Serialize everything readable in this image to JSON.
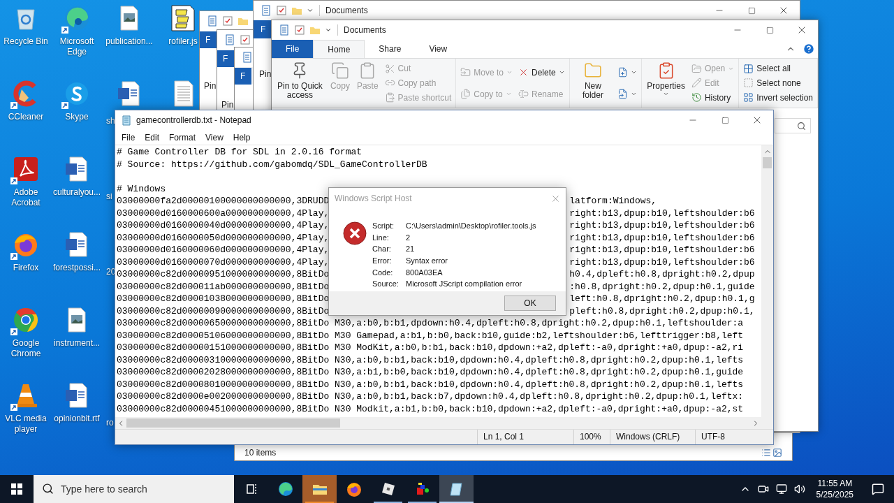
{
  "desktop": {
    "icons": [
      {
        "label": "Recycle Bin",
        "kind": "recycle",
        "shortcut": false
      },
      {
        "label": "Microsoft Edge",
        "kind": "edge",
        "shortcut": true
      },
      {
        "label": "publication...",
        "kind": "image",
        "shortcut": false
      },
      {
        "label": "rofiler.js",
        "kind": "script",
        "shortcut": false
      },
      {
        "label": "CCleaner",
        "kind": "ccleaner",
        "shortcut": true
      },
      {
        "label": "Skype",
        "kind": "skype",
        "shortcut": true
      },
      {
        "label": "sh",
        "kind": "word",
        "shortcut": false
      },
      {
        "kind": "text",
        "shortcut": false
      },
      {
        "label": "Adobe Acrobat",
        "kind": "acrobat",
        "shortcut": true
      },
      {
        "label": "culturalyou...",
        "kind": "word",
        "shortcut": false
      },
      {
        "label": "si",
        "kind": "none"
      },
      {
        "label": "Firefox",
        "kind": "firefox",
        "shortcut": true
      },
      {
        "label": "forestpossi...",
        "kind": "word",
        "shortcut": false
      },
      {
        "label": "20",
        "kind": "none"
      },
      {
        "label": "Google Chrome",
        "kind": "chrome",
        "shortcut": true
      },
      {
        "label": "instrument...",
        "kind": "image",
        "shortcut": false
      },
      {
        "label": "VLC media player",
        "kind": "vlc",
        "shortcut": true
      },
      {
        "label": "opinionbit.rtf",
        "kind": "word",
        "shortcut": false
      },
      {
        "label": "ro",
        "kind": "none"
      }
    ]
  },
  "background_windows": [
    {
      "file_tab": "F",
      "pin": "Pin"
    },
    {
      "file_tab": "F",
      "pin": "Pin"
    },
    {
      "file_tab": "F",
      "status": "10 items"
    }
  ],
  "back_explorer": {
    "title": "Documents",
    "file_tab": "F",
    "pin": "Pin"
  },
  "explorer": {
    "title": "Documents",
    "tabs": [
      {
        "label": "File",
        "kind": "file",
        "selected": false
      },
      {
        "label": "Home",
        "kind": "tab",
        "selected": true
      },
      {
        "label": "Share",
        "kind": "tab",
        "selected": false
      },
      {
        "label": "View",
        "kind": "tab",
        "selected": false
      }
    ],
    "ribbon": [
      [
        [
          {
            "label": "Pin to Quick access",
            "kind": "pin",
            "disabled": false,
            "menu": false
          }
        ],
        [
          {
            "label": "Copy",
            "kind": "copy",
            "disabled": true,
            "menu": false
          }
        ],
        [
          {
            "label": "Paste",
            "kind": "paste",
            "disabled": true,
            "menu": false
          }
        ],
        [
          {
            "label": "Cut",
            "kind": "cut",
            "disabled": true,
            "menu": false
          },
          {
            "label": "Copy path",
            "kind": "copypath",
            "disabled": true,
            "menu": false
          },
          {
            "label": "Paste shortcut",
            "kind": "pasteshortcut",
            "disabled": true,
            "menu": false
          }
        ]
      ],
      [
        [
          {
            "label": "Move to",
            "kind": "moveto",
            "disabled": true,
            "menu": true
          },
          {
            "label": "Copy to",
            "kind": "copyto",
            "disabled": true,
            "menu": true
          }
        ],
        [
          {
            "label": "Delete",
            "kind": "delete",
            "disabled": false,
            "menu": true
          },
          {
            "label": "Rename",
            "kind": "rename",
            "disabled": true,
            "menu": false
          }
        ]
      ],
      [
        [
          {
            "label": "New folder",
            "kind": "newfolder",
            "disabled": false,
            "menu": false
          }
        ],
        [
          {
            "kind": "newitem",
            "disabled": false,
            "menu": true
          },
          {
            "kind": "easyaccess",
            "disabled": false,
            "menu": true
          }
        ]
      ],
      [
        [
          {
            "label": "Properties",
            "kind": "properties",
            "disabled": false,
            "menu": true
          }
        ],
        [
          {
            "label": "Open",
            "kind": "open",
            "disabled": true,
            "menu": true
          },
          {
            "label": "Edit",
            "kind": "edit",
            "disabled": true,
            "menu": false
          },
          {
            "label": "History",
            "kind": "history",
            "disabled": false,
            "menu": false
          }
        ]
      ],
      [
        [
          {
            "label": "Select all",
            "kind": "selectall",
            "disabled": false,
            "menu": false
          },
          {
            "label": "Select none",
            "kind": "selectnone",
            "disabled": false,
            "menu": false
          },
          {
            "label": "Invert selection",
            "kind": "invert",
            "disabled": false,
            "menu": false
          }
        ]
      ]
    ]
  },
  "notepad": {
    "title": "gamecontrollerdb.txt - Notepad",
    "menu": [
      "File",
      "Edit",
      "Format",
      "View",
      "Help"
    ],
    "lines": [
      {
        "kind": "full",
        "text": "# Game Controller DB for SDL in 2.0.16 format"
      },
      {
        "kind": "full",
        "text": "# Source: https://github.com/gabomdq/SDL_GameControllerDB"
      },
      {
        "kind": "blank"
      },
      {
        "kind": "full",
        "text": "# Windows"
      },
      {
        "kind": "split",
        "left": "03000000fa2d00000100000000000000,3DRUDD",
        "right": "latform:Windows,"
      },
      {
        "kind": "split",
        "left": "03000000d0160000600a000000000000,4Play,",
        "right": "right:b13,dpup:b10,leftshoulder:b6"
      },
      {
        "kind": "split",
        "left": "03000000d0160000040d000000000000,4Play,",
        "right": "right:b13,dpup:b10,leftshoulder:b6"
      },
      {
        "kind": "split",
        "left": "03000000d0160000050d000000000000,4Play,",
        "right": "right:b13,dpup:b10,leftshoulder:b6"
      },
      {
        "kind": "split",
        "left": "03000000d0160000060d000000000000,4Play,",
        "right": "right:b13,dpup:b10,leftshoulder:b6"
      },
      {
        "kind": "split",
        "left": "03000000d0160000070d000000000000,4Play,",
        "right": "right:b13,dpup:b10,leftshoulder:b6"
      },
      {
        "kind": "split",
        "left": "03000000c82d00000951000000000000,8BitDo",
        "right": "h0.4,dpleft:h0.8,dpright:h0.2,dpup"
      },
      {
        "kind": "split",
        "left": "03000000c82d000011ab000000000000,8BitDo",
        "right": ":h0.8,dpright:h0.2,dpup:h0.1,guide"
      },
      {
        "kind": "split",
        "left": "03000000c82d00001038000000000000,8BitDo",
        "right": "left:h0.8,dpright:h0.2,dpup:h0.1,g"
      },
      {
        "kind": "split",
        "left": "03000000c82d00000090000000000000,8BitDo",
        "right": "pleft:h0.8,dpright:h0.2,dpup:h0.1,"
      },
      {
        "kind": "full",
        "text": "03000000c82d00000650000000000000,8BitDo M30,a:b0,b:b1,dpdown:h0.4,dpleft:h0.8,dpright:h0.2,dpup:h0.1,leftshoulder:a"
      },
      {
        "kind": "full",
        "text": "03000000c82d00005106000000000000,8BitDo M30 Gamepad,a:b1,b:b0,back:b10,guide:b2,leftshoulder:b6,lefttrigger:b8,left"
      },
      {
        "kind": "full",
        "text": "03000000c82d00000151000000000000,8BitDo M30 ModKit,a:b0,b:b1,back:b10,dpdown:+a2,dpleft:-a0,dpright:+a0,dpup:-a2,ri"
      },
      {
        "kind": "full",
        "text": "03000000c82d00000310000000000000,8BitDo N30,a:b0,b:b1,back:b10,dpdown:h0.4,dpleft:h0.8,dpright:h0.2,dpup:h0.1,lefts"
      },
      {
        "kind": "full",
        "text": "03000000c82d00002028000000000000,8BitDo N30,a:b1,b:b0,back:b10,dpdown:h0.4,dpleft:h0.8,dpright:h0.2,dpup:h0.1,guide"
      },
      {
        "kind": "full",
        "text": "03000000c82d00008010000000000000,8BitDo N30,a:b0,b:b1,back:b10,dpdown:h0.4,dpleft:h0.8,dpright:h0.2,dpup:h0.1,lefts"
      },
      {
        "kind": "full",
        "text": "03000000c82d0000e002000000000000,8BitDo N30,a:b0,b:b1,back:b7,dpdown:h0.4,dpleft:h0.8,dpright:h0.2,dpup:h0.1,leftx:"
      },
      {
        "kind": "full",
        "text": "03000000c82d00000451000000000000,8BitDo N30 Modkit,a:b1,b:b0,back:b10,dpdown:+a2,dpleft:-a0,dpright:+a0,dpup:-a2,st"
      }
    ],
    "status": [
      "Ln 1, Col 1",
      "100%",
      "Windows (CRLF)",
      "UTF-8"
    ]
  },
  "dialog": {
    "title": "Windows Script Host",
    "fields": [
      {
        "label": "Script:",
        "value": "C:\\Users\\admin\\Desktop\\rofiler.tools.js"
      },
      {
        "label": "Line:",
        "value": "2"
      },
      {
        "label": "Char:",
        "value": "21"
      },
      {
        "label": "Error:",
        "value": "Syntax error"
      },
      {
        "label": "Code:",
        "value": "800A03EA"
      },
      {
        "label": "Source:",
        "value": "Microsoft JScript compilation error"
      }
    ],
    "button": "OK"
  },
  "taskbar": {
    "search": {
      "placeholder": "Type here to search"
    },
    "apps": [
      {
        "kind": "taskview",
        "running": false,
        "flashing": false,
        "selected": false
      },
      {
        "kind": "edge",
        "running": false,
        "flashing": false,
        "selected": false
      },
      {
        "kind": "explorer",
        "running": true,
        "flashing": true,
        "selected": false
      },
      {
        "kind": "firefox",
        "running": false,
        "flashing": false,
        "selected": false
      },
      {
        "kind": "roblox",
        "running": true,
        "flashing": false,
        "selected": false
      },
      {
        "kind": "app",
        "running": true,
        "flashing": false,
        "selected": false
      },
      {
        "kind": "notepad",
        "running": true,
        "flashing": false,
        "selected": true
      }
    ],
    "time": "11:55 AM",
    "date": "5/25/2025"
  }
}
